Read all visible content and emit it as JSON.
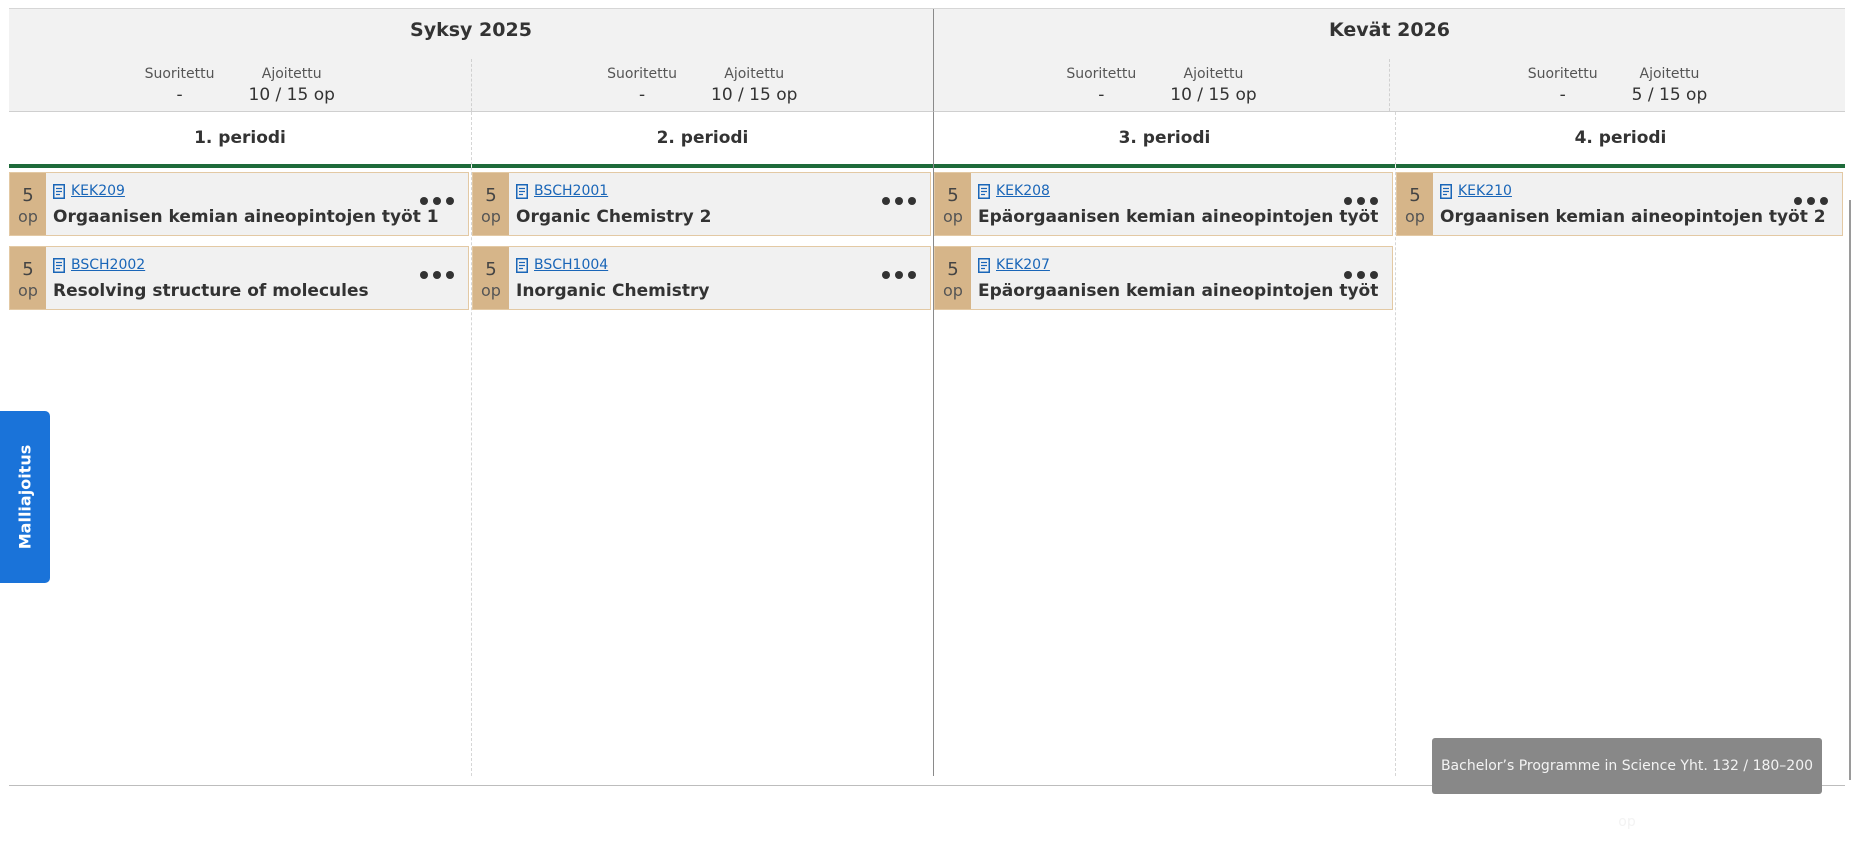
{
  "semesters": [
    {
      "title": "Syksy 2025",
      "stats": [
        {
          "completed_label": "Suoritettu",
          "completed_value": "-",
          "scheduled_label": "Ajoitettu",
          "scheduled_value": "10 / 15 op"
        },
        {
          "completed_label": "Suoritettu",
          "completed_value": "-",
          "scheduled_label": "Ajoitettu",
          "scheduled_value": "10 / 15 op"
        }
      ]
    },
    {
      "title": "Kevät 2026",
      "stats": [
        {
          "completed_label": "Suoritettu",
          "completed_value": "-",
          "scheduled_label": "Ajoitettu",
          "scheduled_value": "10 / 15 op"
        },
        {
          "completed_label": "Suoritettu",
          "completed_value": "-",
          "scheduled_label": "Ajoitettu",
          "scheduled_value": "5 / 15 op"
        }
      ]
    }
  ],
  "periods": [
    {
      "title": "1. periodi",
      "courses": [
        {
          "credits": "5",
          "unit": "op",
          "code": "KEK209",
          "name": "Orgaanisen kemian aineopintojen työt 1"
        },
        {
          "credits": "5",
          "unit": "op",
          "code": "BSCH2002",
          "name": "Resolving structure of molecules"
        }
      ]
    },
    {
      "title": "2. periodi",
      "courses": [
        {
          "credits": "5",
          "unit": "op",
          "code": "BSCH2001",
          "name": "Organic Chemistry 2"
        },
        {
          "credits": "5",
          "unit": "op",
          "code": "BSCH1004",
          "name": "Inorganic Chemistry"
        }
      ]
    },
    {
      "title": "3. periodi",
      "courses": [
        {
          "credits": "5",
          "unit": "op",
          "code": "KEK208",
          "name": "Epäorgaanisen kemian aineopintojen työt"
        },
        {
          "credits": "5",
          "unit": "op",
          "code": "KEK207",
          "name": "Epäorgaanisen kemian aineopintojen työt"
        }
      ]
    },
    {
      "title": "4. periodi",
      "courses": [
        {
          "credits": "5",
          "unit": "op",
          "code": "KEK210",
          "name": "Orgaanisen kemian aineopintojen työt 2"
        }
      ]
    }
  ],
  "side_tab": {
    "label": "Malliajoitus"
  },
  "summary": {
    "text": "Bachelor’s Programme in Science Yht. 132 / 180–200 op"
  },
  "colors": {
    "accent": "#1a73d9",
    "credit_badge": "#d6b589",
    "period_bar": "#1e6b3a",
    "link": "#1a66b8"
  },
  "icons": {
    "course_icon": "document-icon",
    "more": "more-horizontal-icon"
  }
}
